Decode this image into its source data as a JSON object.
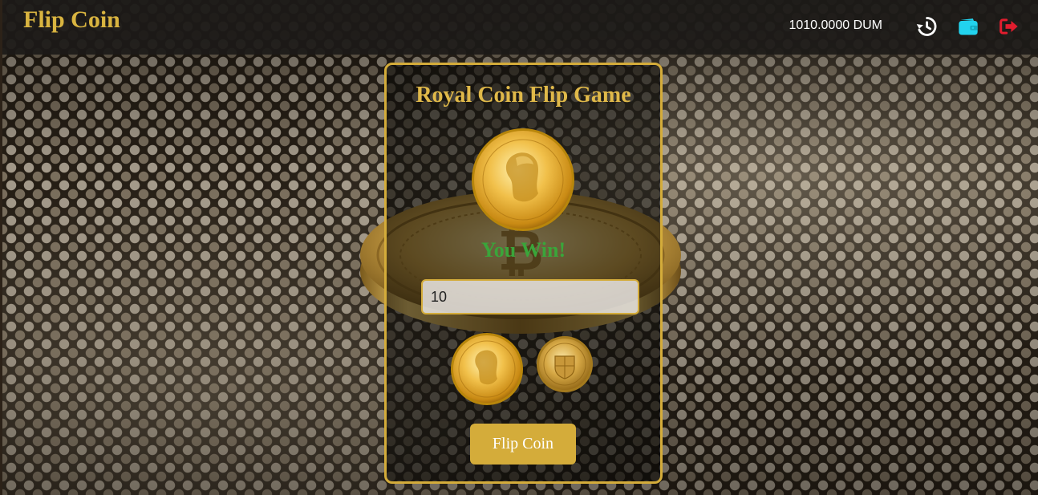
{
  "header": {
    "brand": "Flip Coin",
    "balance": "1010.0000 DUM",
    "icons": [
      "history-icon",
      "wallet-icon",
      "logout-icon"
    ]
  },
  "game": {
    "title": "Royal Coin Flip Game",
    "result": "You Win!",
    "bet_value": "10",
    "sides": [
      "heads-coin-icon",
      "tails-coin-icon"
    ],
    "flip_label": "Flip Coin"
  },
  "colors": {
    "gold": "#d4ac3a",
    "win_green": "#3aa53a",
    "wallet_cyan": "#22d3ee",
    "logout_red": "#e11d2e"
  }
}
